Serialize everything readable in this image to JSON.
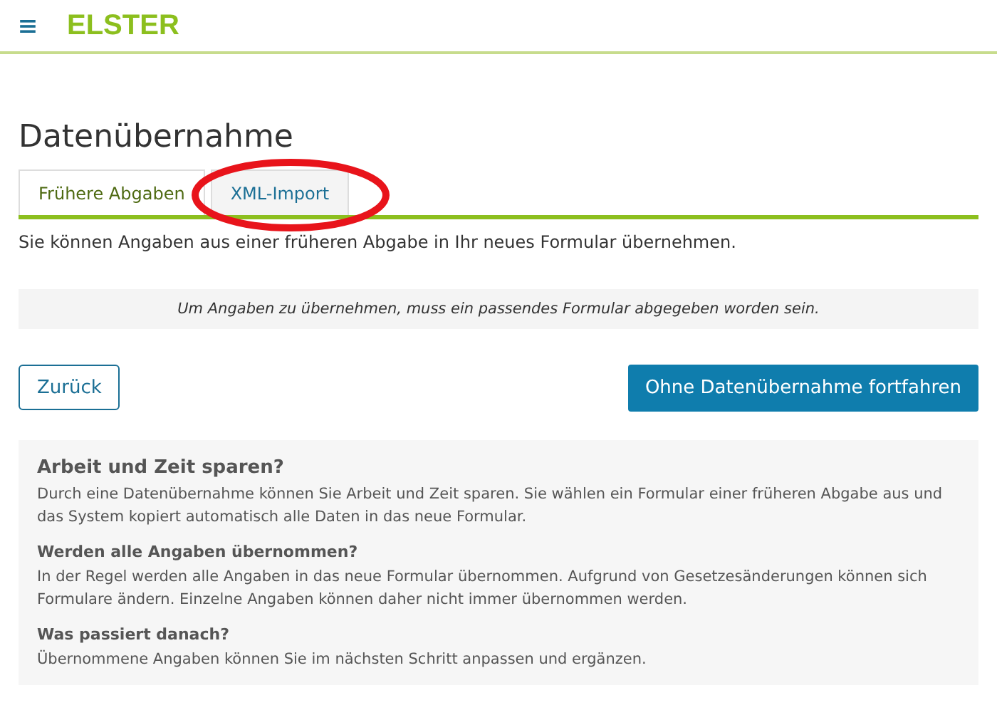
{
  "header": {
    "logo": "ELSTER"
  },
  "page": {
    "title": "Datenübernahme"
  },
  "tabs": [
    {
      "label": "Frühere Abgaben",
      "selected": true
    },
    {
      "label": "XML-Import",
      "selected": false
    }
  ],
  "intro": "Sie können Angaben aus einer früheren Abgabe in Ihr neues Formular übernehmen.",
  "notice": "Um Angaben zu übernehmen, muss ein passendes Formular abgegeben worden sein.",
  "buttons": {
    "back": "Zurück",
    "continue": "Ohne Datenübernahme fortfahren"
  },
  "info": [
    {
      "heading": "Arbeit und Zeit sparen?",
      "kind": "major",
      "text": "Durch eine Datenübernahme können Sie Arbeit und Zeit sparen. Sie wählen ein Formular einer früheren Abgabe aus und das System kopiert automatisch alle Daten in das neue Formular."
    },
    {
      "heading": "Werden alle Angaben übernommen?",
      "kind": "minor",
      "text": "In der Regel werden alle Angaben in das neue Formular übernommen. Aufgrund von Gesetzesänderungen können sich Formulare ändern. Einzelne Angaben können daher nicht immer übernommen werden."
    },
    {
      "heading": "Was passiert danach?",
      "kind": "minor",
      "text": "Übernommene Angaben können Sie im nächsten Schritt anpassen und ergänzen."
    }
  ]
}
